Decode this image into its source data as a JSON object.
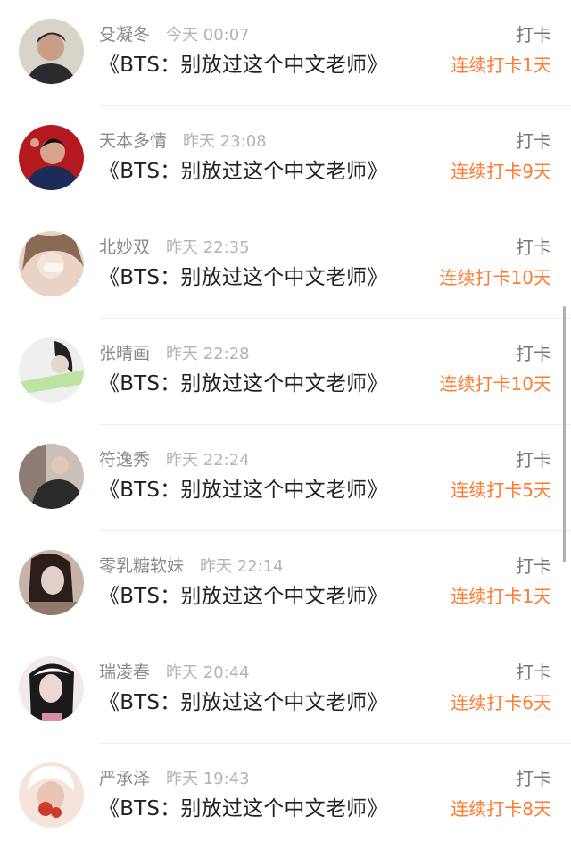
{
  "items": [
    {
      "name": "殳凝冬",
      "time": "今天 00:07",
      "title": "《BTS：别放过这个中文老师》",
      "action": "打卡",
      "streak": "连续打卡1天",
      "avatar_colors": [
        "#d9d4ca",
        "#2b2a2e",
        "#c89f86"
      ]
    },
    {
      "name": "天本多情",
      "time": "昨天 23:08",
      "title": "《BTS：别放过这个中文老师》",
      "action": "打卡",
      "streak": "连续打卡9天",
      "avatar_colors": [
        "#b3191f",
        "#1c2b57",
        "#d6a48a"
      ]
    },
    {
      "name": "北妙双",
      "time": "昨天 22:35",
      "title": "《BTS：别放过这个中文老师》",
      "action": "打卡",
      "streak": "连续打卡10天",
      "avatar_colors": [
        "#e8d3c5",
        "#8a6a55",
        "#f3e3d8"
      ]
    },
    {
      "name": "张晴画",
      "time": "昨天 22:28",
      "title": "《BTS：别放过这个中文老师》",
      "action": "打卡",
      "streak": "连续打卡10天",
      "avatar_colors": [
        "#efefef",
        "#222222",
        "#bfe3a4"
      ]
    },
    {
      "name": "符逸秀",
      "time": "昨天 22:24",
      "title": "《BTS：别放过这个中文老师》",
      "action": "打卡",
      "streak": "连续打卡5天",
      "avatar_colors": [
        "#cbbfb7",
        "#2a2a2a",
        "#8d7c73"
      ]
    },
    {
      "name": "零乳糖软妹",
      "time": "昨天 22:14",
      "title": "《BTS：别放过这个中文老师》",
      "action": "打卡",
      "streak": "连续打卡1天",
      "avatar_colors": [
        "#c7b3aa",
        "#2b1d1a",
        "#e2cfc8"
      ]
    },
    {
      "name": "瑞凌春",
      "time": "昨天 20:44",
      "title": "《BTS：别放过这个中文老师》",
      "action": "打卡",
      "streak": "连续打卡6天",
      "avatar_colors": [
        "#f1e9ed",
        "#1a1a1a",
        "#d88fa6"
      ]
    },
    {
      "name": "严承泽",
      "time": "昨天 19:43",
      "title": "《BTS：别放过这个中文老师》",
      "action": "打卡",
      "streak": "连续打卡8天",
      "avatar_colors": [
        "#f5e4dc",
        "#cc3c2e",
        "#e7c4b4"
      ]
    }
  ],
  "scrollbar_color": "#b0b0b0"
}
